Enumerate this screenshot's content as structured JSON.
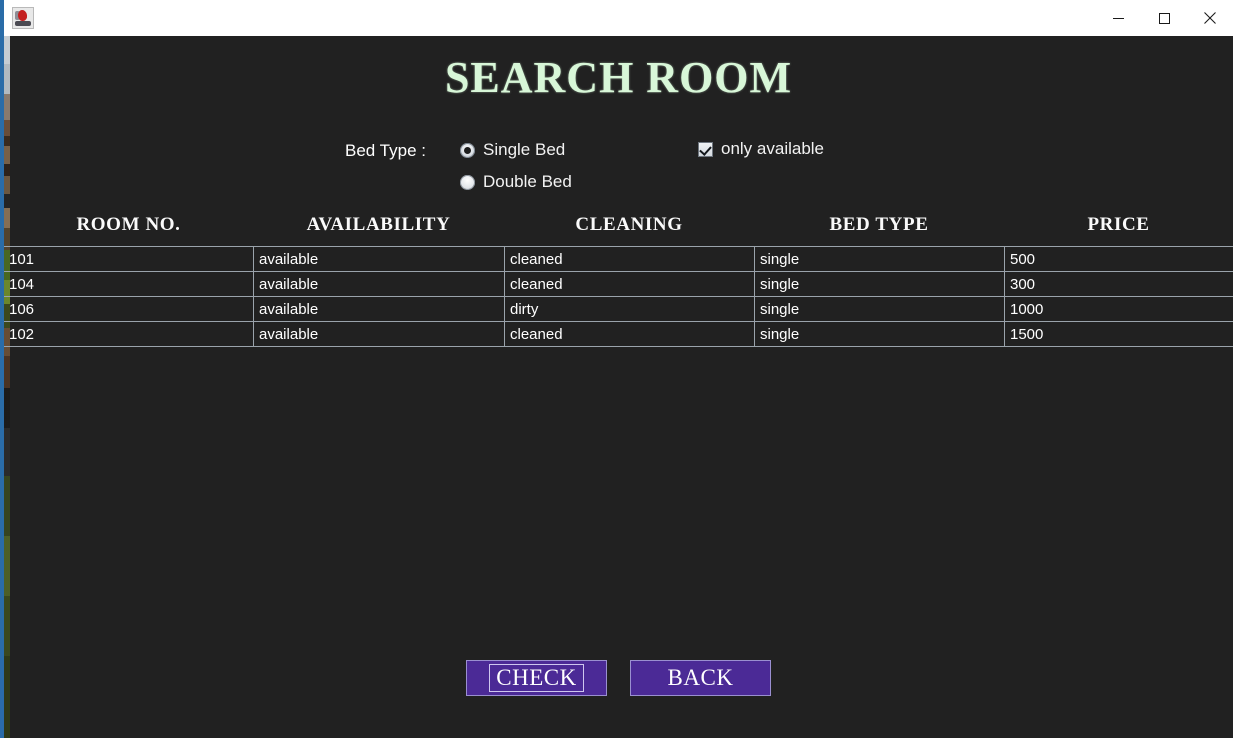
{
  "window": {
    "title": "",
    "icon": "java-app-icon",
    "controls": {
      "minimize": "minimize-icon",
      "maximize": "maximize-icon",
      "close": "close-icon"
    }
  },
  "page": {
    "title": "SEARCH  ROOM",
    "title_color": "#d8f7d8",
    "background_color": "#212121"
  },
  "filters": {
    "bed_type_label": "Bed Type :",
    "bed_type_options": [
      {
        "label": "Single Bed",
        "selected": true
      },
      {
        "label": "Double Bed",
        "selected": false
      }
    ],
    "only_available": {
      "label": "only available",
      "checked": true
    }
  },
  "table": {
    "columns": [
      "ROOM NO.",
      "AVAILABILITY",
      "CLEANING",
      "BED TYPE",
      "PRICE"
    ],
    "rows": [
      {
        "room_no": "101",
        "availability": "available",
        "cleaning": "cleaned",
        "bed_type": "single",
        "price": "500"
      },
      {
        "room_no": "104",
        "availability": "available",
        "cleaning": "cleaned",
        "bed_type": "single",
        "price": "300"
      },
      {
        "room_no": "106",
        "availability": "available",
        "cleaning": "dirty",
        "bed_type": "single",
        "price": "1000"
      },
      {
        "room_no": "102",
        "availability": "available",
        "cleaning": "cleaned",
        "bed_type": "single",
        "price": "1500"
      }
    ]
  },
  "buttons": {
    "check": "CHECK",
    "back": "BACK",
    "accent_color": "#4b2a96"
  }
}
